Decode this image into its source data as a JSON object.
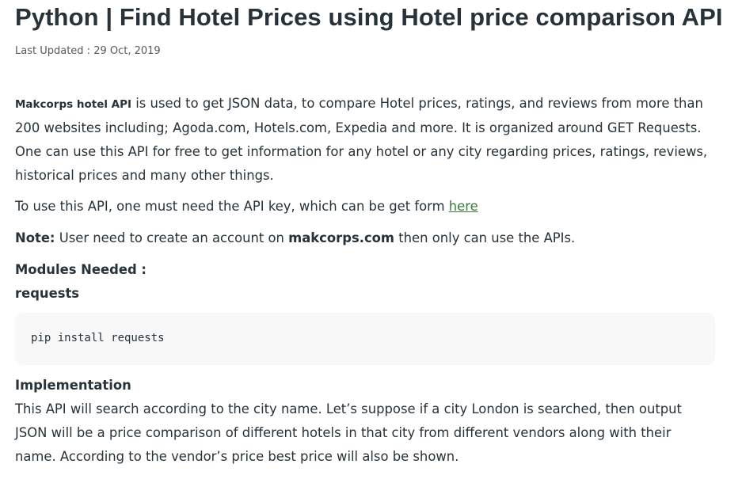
{
  "article": {
    "title": "Python | Find Hotel Prices using Hotel price comparison API",
    "last_updated": "Last Updated : 29 Oct, 2019",
    "intro": {
      "lead_bold": "Makcorps hotel API",
      "text": " is used to get JSON data, to compare Hotel prices, ratings, and reviews from more than 200 websites including; Agoda.com, Hotels.com, Expedia and more. It is organized around GET Requests. One can use this API for free to get information for any hotel or any city regarding prices, ratings, reviews, historical prices and many other things."
    },
    "api_key": {
      "text": "To use this API, one must need the API key, which can be get form ",
      "link_label": "here"
    },
    "note": {
      "label": "Note:",
      "text_before": " User need to create an account on ",
      "site": "makcorps.com",
      "text_after": " then only can use the APIs."
    },
    "modules_heading": "Modules Needed :",
    "requests_heading": "requests",
    "code": "pip install requests",
    "implementation_heading": "Implementation",
    "implementation_text": "This API will search according to the city name. Let’s suppose if a city London is searched, then output JSON will be a price comparison of different hotels in that city from different vendors along with their name. According to the vendor’s price best price will also be shown."
  }
}
